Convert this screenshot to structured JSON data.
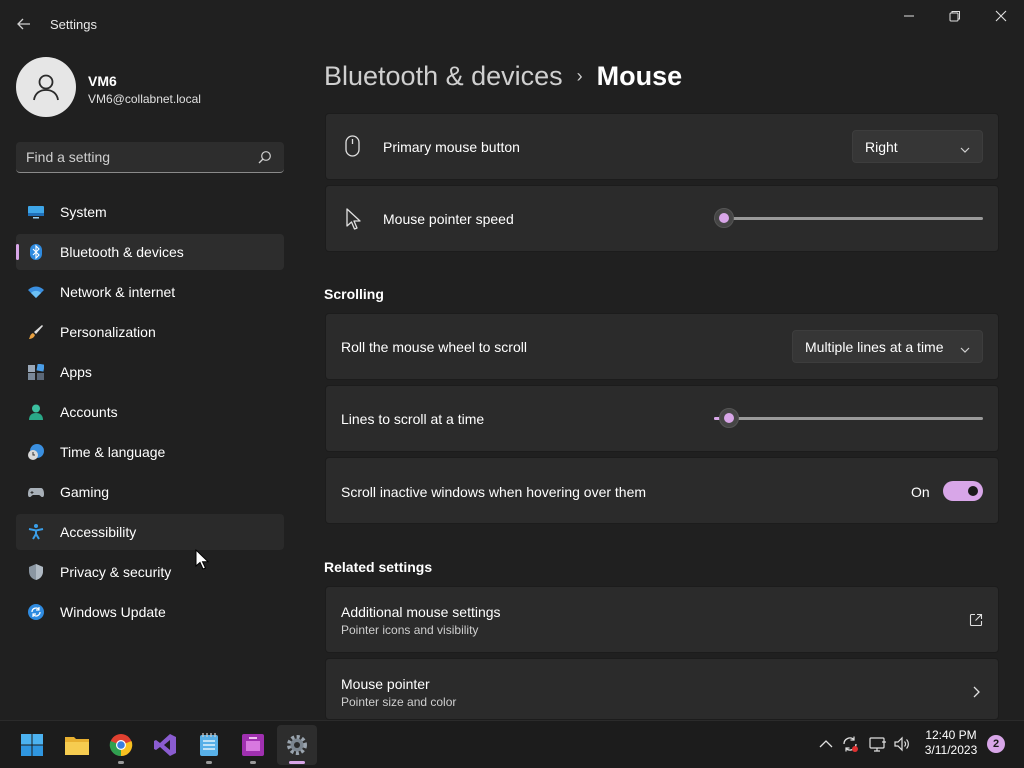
{
  "window": {
    "title": "Settings"
  },
  "user": {
    "name": "VM6",
    "email": "VM6@collabnet.local"
  },
  "search": {
    "placeholder": "Find a setting"
  },
  "sidebar": {
    "items": [
      {
        "label": "System",
        "icon": "system-icon"
      },
      {
        "label": "Bluetooth & devices",
        "icon": "bluetooth-icon"
      },
      {
        "label": "Network & internet",
        "icon": "wifi-icon"
      },
      {
        "label": "Personalization",
        "icon": "brush-icon"
      },
      {
        "label": "Apps",
        "icon": "apps-icon"
      },
      {
        "label": "Accounts",
        "icon": "person-icon"
      },
      {
        "label": "Time & language",
        "icon": "clock-globe-icon"
      },
      {
        "label": "Gaming",
        "icon": "gamepad-icon"
      },
      {
        "label": "Accessibility",
        "icon": "accessibility-icon"
      },
      {
        "label": "Privacy & security",
        "icon": "shield-icon"
      },
      {
        "label": "Windows Update",
        "icon": "update-icon"
      }
    ],
    "selected": "Bluetooth & devices"
  },
  "breadcrumb": {
    "parent": "Bluetooth & devices",
    "separator": "›",
    "current": "Mouse"
  },
  "settings": {
    "primary_button": {
      "label": "Primary mouse button",
      "value": "Right"
    },
    "pointer_speed": {
      "label": "Mouse pointer speed",
      "level": 0.0
    },
    "scrolling_title": "Scrolling",
    "roll_wheel": {
      "label": "Roll the mouse wheel to scroll",
      "value": "Multiple lines at a time"
    },
    "lines_to_scroll": {
      "label": "Lines to scroll at a time",
      "level": 0.02
    },
    "scroll_inactive": {
      "label": "Scroll inactive windows when hovering over them",
      "state": "On"
    },
    "related_title": "Related settings",
    "additional_mouse": {
      "label": "Additional mouse settings",
      "desc": "Pointer icons and visibility"
    },
    "mouse_pointer": {
      "label": "Mouse pointer",
      "desc": "Pointer size and color"
    }
  },
  "taskbar": {
    "apps": [
      "start-icon",
      "file-explorer-icon",
      "chrome-icon",
      "visual-studio-icon",
      "notepad-icon",
      "app-icon",
      "settings-icon"
    ],
    "time": "12:40 PM",
    "date": "3/11/2023",
    "notifications": "2"
  },
  "colors": {
    "accent": "#d8a6e8",
    "background": "#202020",
    "card": "#2b2b2b"
  }
}
